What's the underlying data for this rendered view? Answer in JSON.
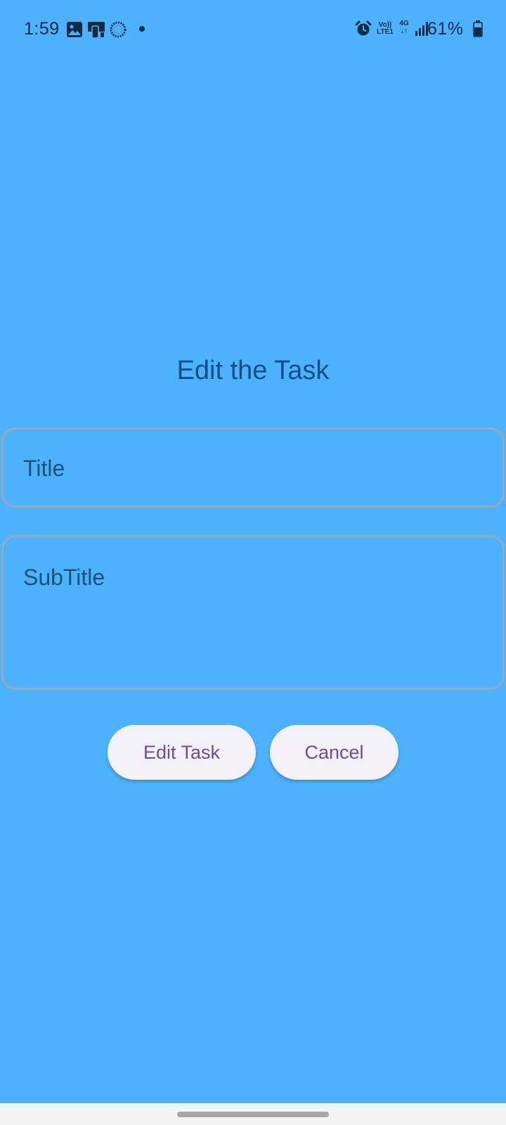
{
  "status_bar": {
    "time": "1:59",
    "left_icons": [
      "image-icon",
      "screen-mirror-icon",
      "sync-circle-icon",
      "notification-dot-icon"
    ],
    "right_icons": [
      "alarm-icon",
      "volte-icon",
      "4g-data-icon",
      "signal-icon",
      "battery-icon"
    ],
    "volte_top": "Vo))",
    "volte_bottom": "LTE1",
    "network_type": "4G",
    "battery_percent": "61%",
    "text_color": "#0f2b45"
  },
  "dialog": {
    "title": "Edit the Task",
    "title_fields": {
      "title_placeholder": "Title",
      "subtitle_placeholder": "SubTitle"
    },
    "buttons": {
      "edit_label": "Edit Task",
      "cancel_label": "Cancel"
    }
  },
  "colors": {
    "background": "#4db2fd",
    "title_text": "#0d4f87",
    "field_border": "#9aa7b3",
    "placeholder_text": "#1c5178",
    "button_background": "#f5f1f8",
    "button_text": "#6b4c9f",
    "nav_bar": "#f4f4f6"
  },
  "nav_bar": {
    "handle_icon": "gesture-handle"
  }
}
